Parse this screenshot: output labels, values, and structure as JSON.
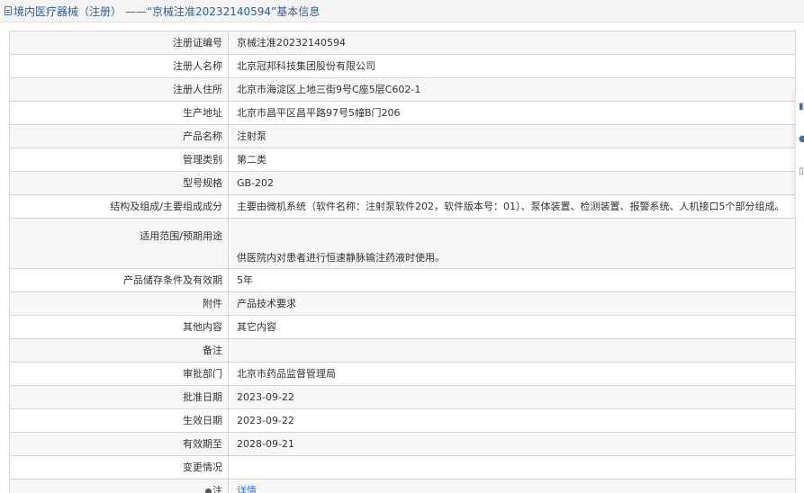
{
  "header": {
    "icon": "document-icon",
    "title": "境内医疗器械（注册） ——“京械注准20232140594”基本信息"
  },
  "fields": [
    {
      "label": "注册证编号",
      "value": "京械注准20232140594"
    },
    {
      "label": "注册人名称",
      "value": "北京冠邦科技集团股份有限公司"
    },
    {
      "label": "注册人住所",
      "value": "北京市海淀区上地三街9号C座5层C602-1"
    },
    {
      "label": "生产地址",
      "value": "北京市昌平区昌平路97号5幢B门206"
    },
    {
      "label": "产品名称",
      "value": "注射泵"
    },
    {
      "label": "管理类别",
      "value": "第二类"
    },
    {
      "label": "型号规格",
      "value": "GB-202"
    },
    {
      "label": "结构及组成/主要组成成分",
      "value": "主要由微机系统（软件名称：注射泵软件202，软件版本号：01）、泵体装置、检测装置、报警系统、人机接口5个部分组成。"
    },
    {
      "label": "适用范围/预期用途",
      "value": "供医院内对患者进行恒速静脉输注药液时使用。"
    },
    {
      "label": "产品储存条件及有效期",
      "value": "5年"
    },
    {
      "label": "附件",
      "value": "产品技术要求"
    },
    {
      "label": "其他内容",
      "value": "其它内容"
    },
    {
      "label": "备注",
      "value": ""
    },
    {
      "label": "审批部门",
      "value": "北京市药品监督管理局"
    },
    {
      "label": "批准日期",
      "value": "2023-09-22"
    },
    {
      "label": "生效日期",
      "value": "2023-09-22"
    },
    {
      "label": "有效期至",
      "value": "2028-09-21"
    },
    {
      "label": "变更情况",
      "value": ""
    },
    {
      "label": "注",
      "value": "详情"
    }
  ],
  "colors": {
    "title": "#2f5e95",
    "link": "#2f6fbf",
    "border": "#d6d6d6",
    "row_alt": "#f7f7f7"
  }
}
